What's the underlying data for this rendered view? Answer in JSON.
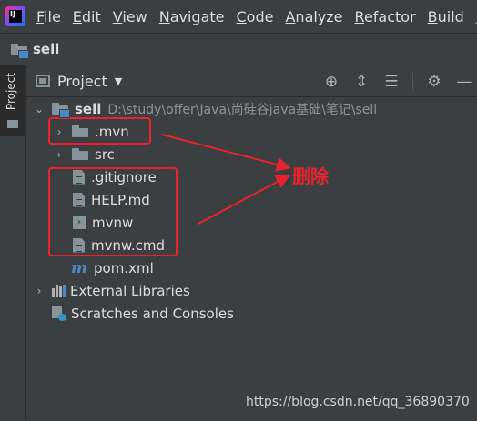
{
  "menubar": {
    "items": [
      "File",
      "Edit",
      "View",
      "Navigate",
      "Code",
      "Analyze",
      "Refactor",
      "Build",
      "R"
    ]
  },
  "breadcrumb": {
    "label": "sell"
  },
  "left_strip": {
    "tab_label": "Project"
  },
  "panel": {
    "title": "Project",
    "tools": [
      "target-icon",
      "expand-icon",
      "collapse-icon",
      "gear-icon",
      "minimize-icon"
    ]
  },
  "tree": {
    "root": {
      "name": "sell",
      "path": "D:\\study\\offer\\Java\\尚硅谷java基础\\笔记\\sell"
    },
    "items": [
      {
        "label": ".mvn",
        "kind": "folder"
      },
      {
        "label": "src",
        "kind": "folder"
      },
      {
        "label": ".gitignore",
        "kind": "file"
      },
      {
        "label": "HELP.md",
        "kind": "markdown"
      },
      {
        "label": "mvnw",
        "kind": "script"
      },
      {
        "label": "mvnw.cmd",
        "kind": "file"
      },
      {
        "label": "pom.xml",
        "kind": "maven"
      }
    ],
    "external_libraries": "External Libraries",
    "scratches": "Scratches and Consoles"
  },
  "annotation": {
    "label": "删除",
    "color": "#e8232d"
  },
  "watermark": "https://blog.csdn.net/qq_36890370"
}
